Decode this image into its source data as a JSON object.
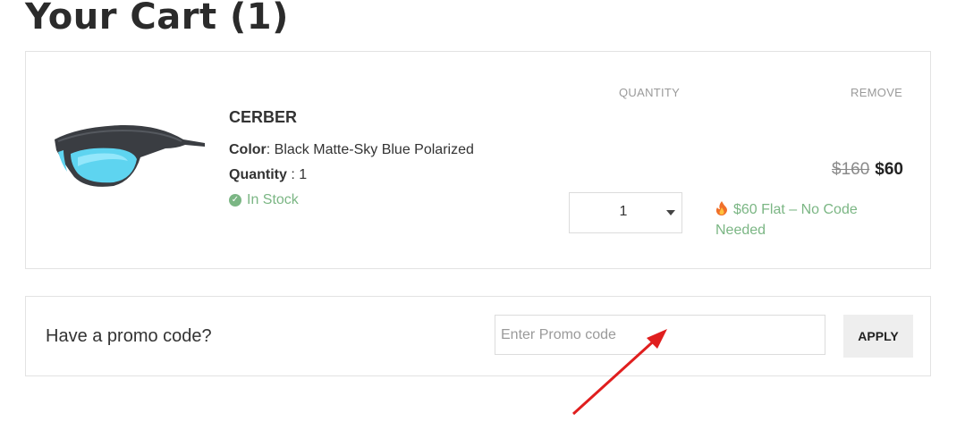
{
  "page": {
    "title": "Your Cart (1)"
  },
  "columns": {
    "quantity": "QUANTITY",
    "remove": "REMOVE"
  },
  "product": {
    "name": "CERBER",
    "color_label": "Color",
    "color_value": "Black Matte-Sky Blue Polarized",
    "quantity_label": "Quantity",
    "quantity_value": "1",
    "stock_status": "In Stock",
    "old_price": "$160",
    "new_price": "$60",
    "selected_quantity": "1",
    "deal_text": "$60 Flat – No Code Needed",
    "image_icon": "sunglasses"
  },
  "promo": {
    "label": "Have a promo code?",
    "placeholder": "Enter Promo code",
    "apply_label": "APPLY"
  },
  "colors": {
    "accent_green": "#7bb684",
    "annotation_red": "#e01e1e"
  }
}
